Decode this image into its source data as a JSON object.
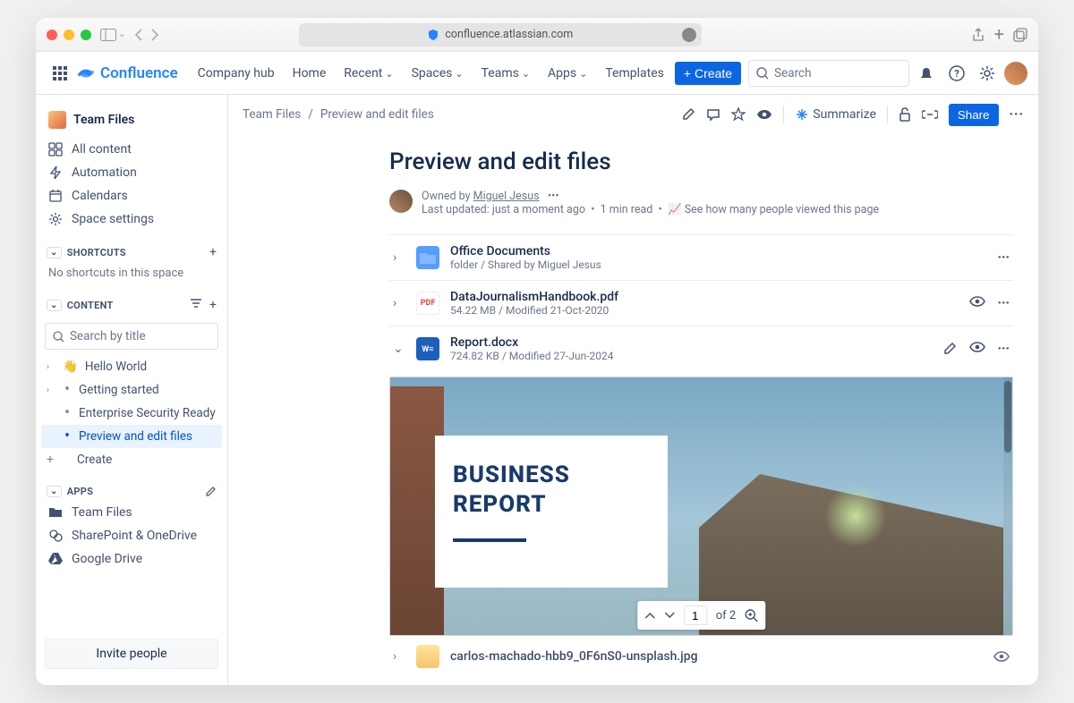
{
  "browser": {
    "url": "confluence.atlassian.com"
  },
  "nav": {
    "brand": "Confluence",
    "items": {
      "hub": "Company hub",
      "home": "Home",
      "recent": "Recent",
      "spaces": "Spaces",
      "teams": "Teams",
      "apps": "Apps",
      "templates": "Templates"
    },
    "create": "Create",
    "search_placeholder": "Search"
  },
  "space": {
    "name": "Team Files",
    "nav": {
      "all": "All content",
      "automation": "Automation",
      "calendars": "Calendars",
      "settings": "Space settings"
    },
    "shortcuts_label": "SHORTCUTS",
    "shortcuts_empty": "No shortcuts in this space",
    "content_label": "CONTENT",
    "search_placeholder": "Search by title",
    "pages": {
      "hello": "Hello World",
      "getting": "Getting started",
      "esr": "Enterprise Security Ready",
      "preview": "Preview and edit files",
      "create": "Create"
    },
    "apps_label": "APPS",
    "apps": {
      "tf": "Team Files",
      "sp": "SharePoint & OneDrive",
      "gd": "Google Drive"
    },
    "invite": "Invite people"
  },
  "page": {
    "crumb_root": "Team Files",
    "crumb_page": "Preview and edit files",
    "title": "Preview and edit files",
    "summarize": "Summarize",
    "share": "Share",
    "owner_prefix": "Owned by ",
    "owner": "Miguel Jesus",
    "updated": "Last updated: just a moment ago",
    "readtime": "1 min read",
    "viewers": "See how many people viewed this page"
  },
  "files": [
    {
      "name": "Office Documents",
      "meta": "folder / Shared by Miguel Jesus"
    },
    {
      "name": "DataJournalismHandbook.pdf",
      "meta": "54.22 MB / Modified 21-Oct-2020"
    },
    {
      "name": "Report.docx",
      "meta": "724.82 KB / Modified 27-Jun-2024"
    },
    {
      "name": "carlos-machado-hbb9_0F6nS0-unsplash.jpg",
      "meta": ""
    }
  ],
  "preview": {
    "heading1": "BUSINESS",
    "heading2": "REPORT",
    "page": "1",
    "total": "of 2"
  }
}
